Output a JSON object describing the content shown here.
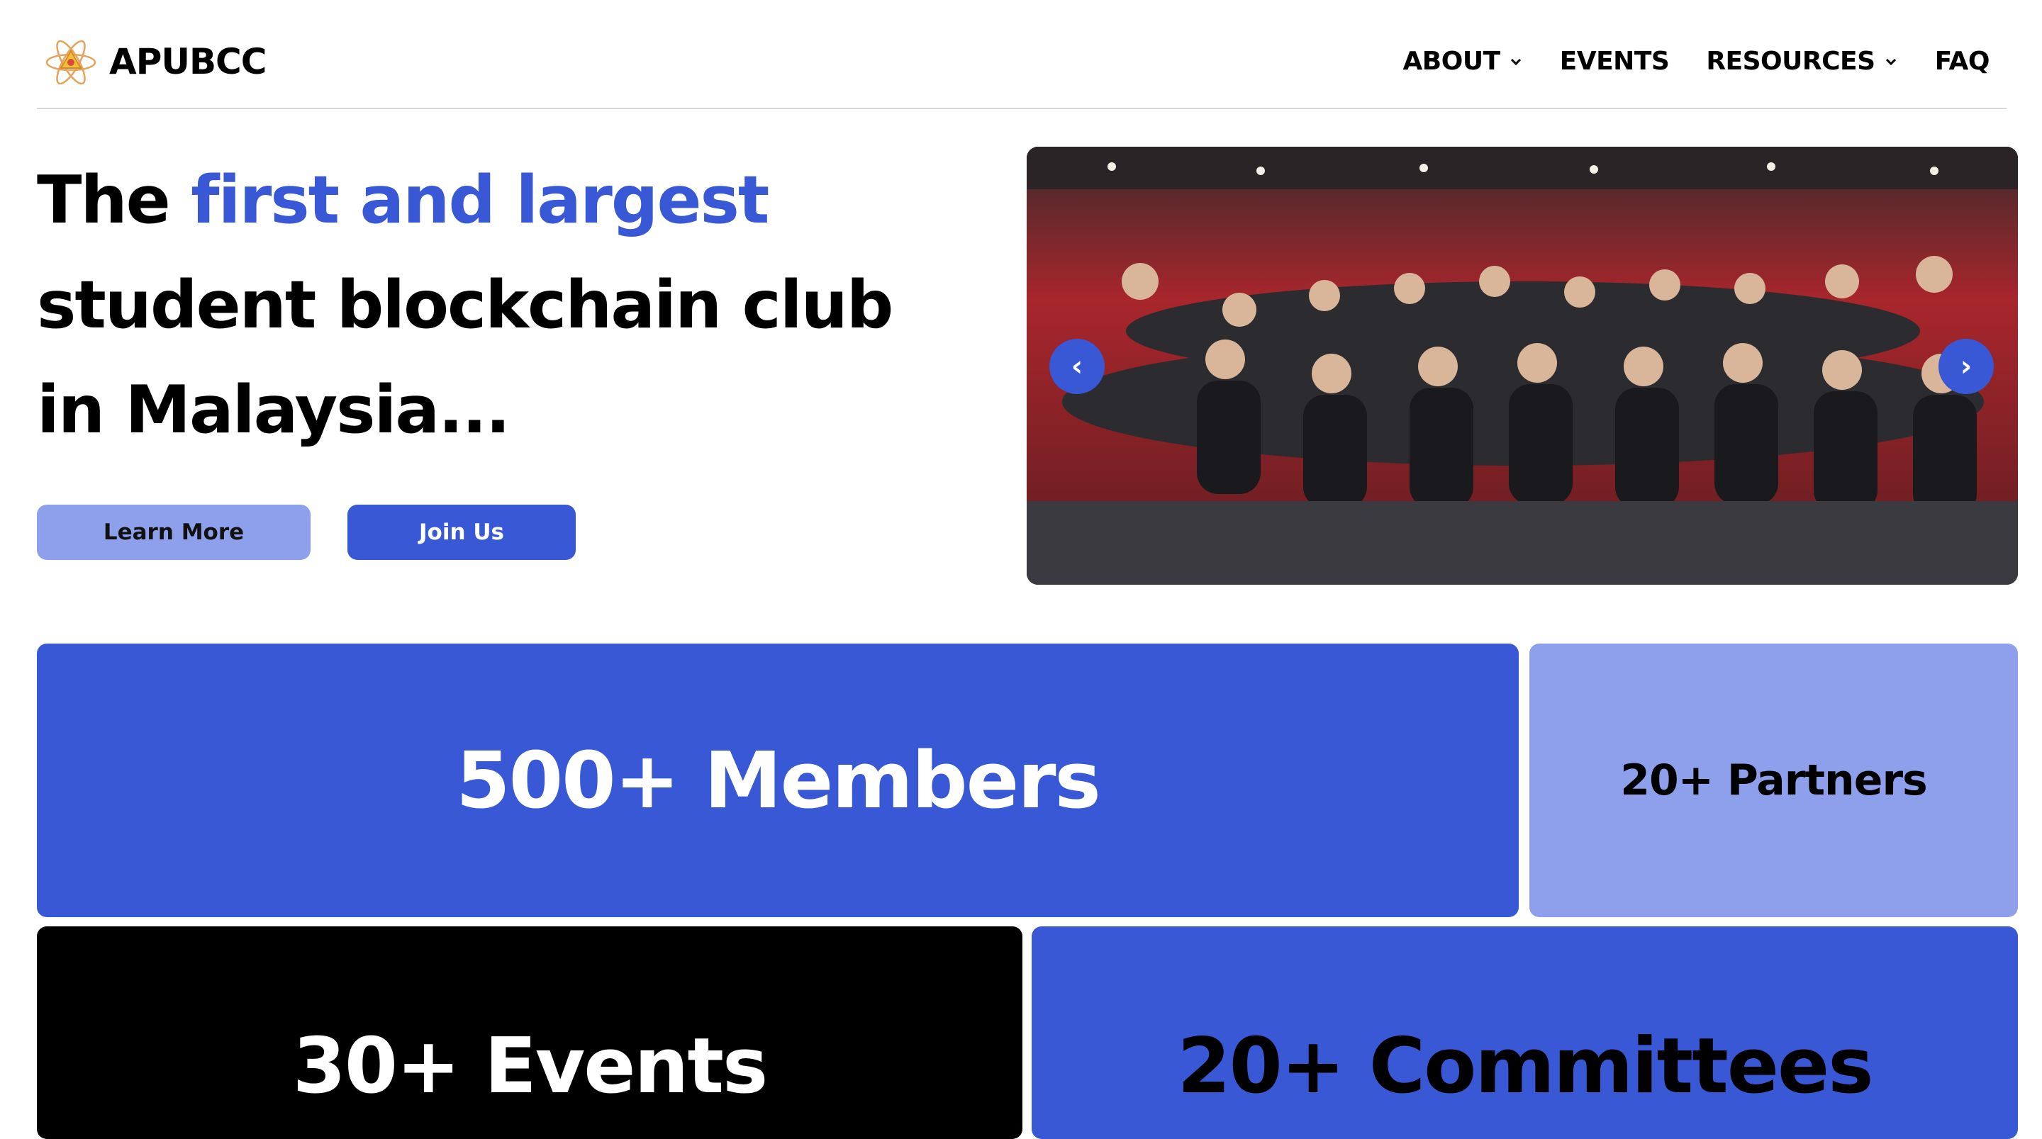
{
  "header": {
    "brand": "APUBCC",
    "logo_icon": "apubcc-logo-icon",
    "nav": [
      {
        "label": "ABOUT",
        "has_dropdown": true
      },
      {
        "label": "EVENTS",
        "has_dropdown": false
      },
      {
        "label": "RESOURCES",
        "has_dropdown": true
      },
      {
        "label": "FAQ",
        "has_dropdown": false
      }
    ]
  },
  "hero": {
    "headline_prefix": "The ",
    "headline_accent": "first and largest",
    "headline_line2": "student blockchain club",
    "headline_line3": "in Malaysia...",
    "learn_more_label": "Learn More",
    "join_us_label": "Join Us"
  },
  "carousel": {
    "prev_label": "‹",
    "next_label": "›",
    "image_alt": "Group photo of club members in a lecture hall"
  },
  "stats": {
    "members": "500+ Members",
    "partners": "20+ Partners",
    "events": "30+ Events",
    "committees": "20+ Committees"
  },
  "colors": {
    "accent": "#3858d6",
    "accent_light": "#8ea0ec",
    "dark": "#000000",
    "text": "#000000"
  }
}
